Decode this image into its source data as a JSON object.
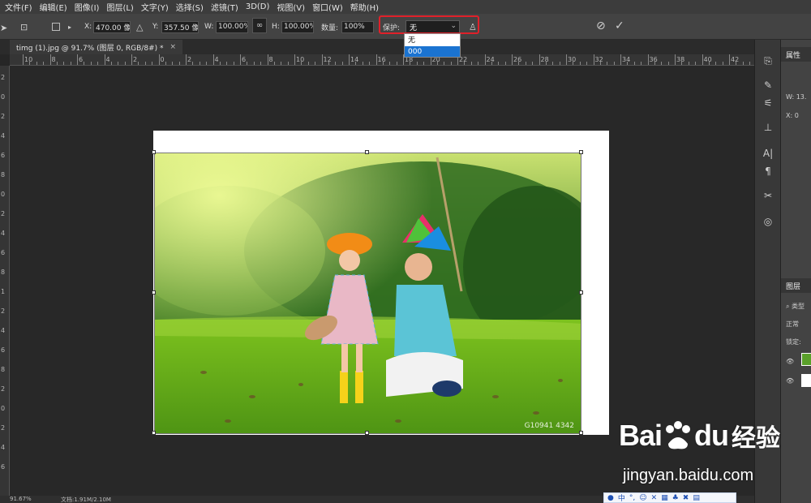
{
  "menu": [
    "文件(F)",
    "编辑(E)",
    "图像(I)",
    "图层(L)",
    "文字(Y)",
    "选择(S)",
    "滤镜(T)",
    "3D(D)",
    "视图(V)",
    "窗口(W)",
    "帮助(H)"
  ],
  "options": {
    "x_label": "X:",
    "x_value": "470.00 像素",
    "y_label": "Y:",
    "y_value": "357.50 像素",
    "w_label": "W:",
    "w_value": "100.00%",
    "h_label": "H:",
    "h_value": "100.00%",
    "amount_label": "数量:",
    "amount_value": "100%",
    "protect_label": "保护:",
    "protect_value": "无",
    "protect_options": [
      "无",
      "000"
    ]
  },
  "document_tab": {
    "title": "timg (1).jpg @ 91.7% (图层 0, RGB/8#) *",
    "close": "×"
  },
  "ruler_top_labels": [
    "10",
    "8",
    "6",
    "4",
    "2",
    "0",
    "2",
    "4",
    "6",
    "8",
    "10",
    "12",
    "14",
    "16",
    "18",
    "20",
    "22",
    "24",
    "26",
    "28",
    "30",
    "32",
    "34",
    "36",
    "38",
    "40",
    "42",
    "44"
  ],
  "ruler_left_labels": [
    "2",
    "0",
    "2",
    "4",
    "6",
    "8",
    "0",
    "2",
    "4",
    "6",
    "8",
    "1",
    "2",
    "4",
    "6",
    "8",
    "2",
    "0",
    "2",
    "4",
    "6"
  ],
  "photo": {
    "watermark_id": "G10941 4342"
  },
  "panels": {
    "properties_tab": "属性",
    "properties_w": "W:",
    "properties_w_value": "13.",
    "properties_x": "X:",
    "properties_x_value": "0",
    "layers_tab": "图层",
    "layers_search": "类型",
    "layers_mode": "正常",
    "layers_lock": "锁定:"
  },
  "status": {
    "zoom": "91.67%",
    "doc": "文档:1.91M/2.10M"
  },
  "baidu": {
    "logo_left": "Bai",
    "logo_right": "du",
    "logo_cn": "经验",
    "url": "jingyan.baidu.com"
  },
  "ime": {
    "mode": "中"
  },
  "colors": {
    "highlight": "#e0202a",
    "selected_option": "#1a73d1"
  }
}
